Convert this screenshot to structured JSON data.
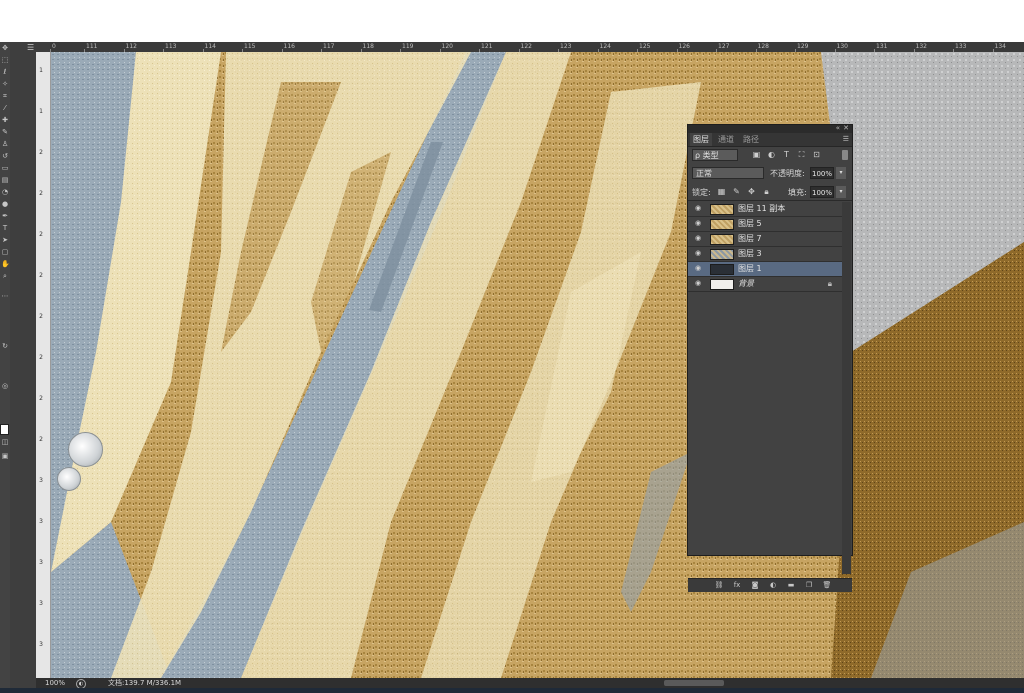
{
  "ruler": {
    "h_labels": [
      "0",
      "111",
      "112",
      "113",
      "114",
      "115",
      "116",
      "117",
      "118",
      "119",
      "120",
      "121",
      "122",
      "123",
      "124",
      "125",
      "126",
      "127",
      "128",
      "129",
      "130",
      "131",
      "132",
      "133",
      "134"
    ],
    "v_labels": [
      "1",
      "1",
      "2",
      "2",
      "2",
      "2",
      "2",
      "2",
      "2",
      "2",
      "3",
      "3",
      "3",
      "3",
      "3"
    ]
  },
  "status": {
    "zoom": "100%",
    "doc": "文档:139.7 M/336.1M"
  },
  "layers_panel": {
    "tabs": [
      "图层",
      "通道",
      "路径"
    ],
    "filter_label": "ρ 类型",
    "blend_mode": "正常",
    "opacity_label": "不透明度:",
    "opacity_value": "100%",
    "lock_label": "锁定:",
    "fill_label": "填充:",
    "fill_value": "100%",
    "layers": [
      {
        "name": "图层 11 副本",
        "thumb": "gold",
        "selected": false,
        "locked": false,
        "italic": false
      },
      {
        "name": "图层 5",
        "thumb": "gold",
        "selected": false,
        "locked": false,
        "italic": false
      },
      {
        "name": "图层 7",
        "thumb": "gold",
        "selected": false,
        "locked": false,
        "italic": false
      },
      {
        "name": "图层 3",
        "thumb": "gray",
        "selected": false,
        "locked": false,
        "italic": false
      },
      {
        "name": "图层 1",
        "thumb": "dark",
        "selected": true,
        "locked": false,
        "italic": false
      },
      {
        "name": "背景",
        "thumb": "white",
        "selected": false,
        "locked": true,
        "italic": true
      }
    ],
    "footer_icons": [
      "link-icon",
      "fx-icon",
      "mask-icon",
      "adjustment-icon",
      "folder-icon",
      "new-layer-icon",
      "trash-icon"
    ]
  },
  "colors": {
    "gold": "#c9a866",
    "cream": "#ece0b6",
    "blue_gray": "#9aa9b6",
    "silver": "#b4b6b7"
  }
}
